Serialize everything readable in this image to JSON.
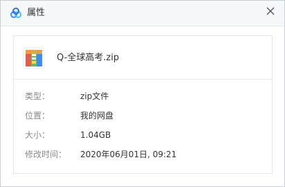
{
  "window": {
    "title": "属性",
    "logo_icon": "cloud-logo-icon",
    "close_icon": "close-icon",
    "accent_color": "#3b8cff"
  },
  "file": {
    "name": "Q-全球高考.zip",
    "icon": "zip-archive-icon"
  },
  "properties": [
    {
      "label": "类型：",
      "value": "zip文件"
    },
    {
      "label": "位置：",
      "value": "我的网盘"
    },
    {
      "label": "大小：",
      "value": "1.04GB"
    },
    {
      "label": "修改时间：",
      "value": "2020年06月01日, 09:21"
    }
  ]
}
